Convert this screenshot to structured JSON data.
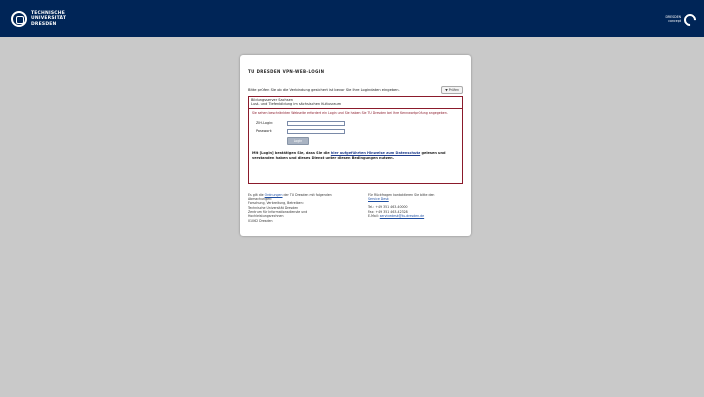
{
  "header": {
    "logo_line1": "TECHNISCHE",
    "logo_line2": "UNIVERSITÄT",
    "logo_line3": "DRESDEN",
    "concept_line1": "DRESDEN",
    "concept_line2": "concept",
    "background_color": "#002557"
  },
  "card": {
    "title": "TU DRESDEN VPN-WEB-LOGIN",
    "cert_prompt": "Bitte prüfen Sie ob die Verbindung gesichert ist bevor Sie Ihre Logindaten eingeben.",
    "cert_button": "▼ Prüfen",
    "required_line1": "Bildungsserver Sachsen",
    "required_line2": "Lust- und Tiefenbildung im sächsischen Kultusraum",
    "intro": "Sie sehen beschränkten Webseite erfordert ein Login und Sie haben Sie TU Dresden bei Ihre Kennwortprüfung angegeben.",
    "login_label": "ZIH-Login:",
    "login_value": "",
    "password_label": "Passwort:",
    "password_value": "",
    "login_button": "Login",
    "consent_prefix": "Mit [Login] bestätigen Sie, dass Sie die",
    "consent_link": "hier aufgeführten Hinweise zum Datenschutz",
    "consent_suffix": "gelesen und verstanden haben und dieses Dienst unter diesen Bedingungen nutzen.",
    "footer_left_prefix": "Es gilt die",
    "footer_left_link": "Ordnungen",
    "footer_left_suffix": "der TU Dresden mit folgenden Abmachungen:",
    "footer_left_lines": [
      "Forschung, Verbreitung, Betreiben:",
      "Technische Universität Dresden",
      "Zentrum für Informationsdienste und",
      "Hochleistungsrechnen",
      "01062 Dresden"
    ],
    "footer_right_line1": "Für Rückfragen kontaktieren Sie bitte den",
    "footer_right_link": "Service Desk",
    "footer_right_tel": "Tel.: +49 351 463-40000",
    "footer_right_fax": "Fax: +49 351 463-42328",
    "footer_right_email_label": "E-Mail:",
    "footer_right_email": "servicedesk@tu-dresden.de",
    "border_color": "#8b1a2b"
  }
}
